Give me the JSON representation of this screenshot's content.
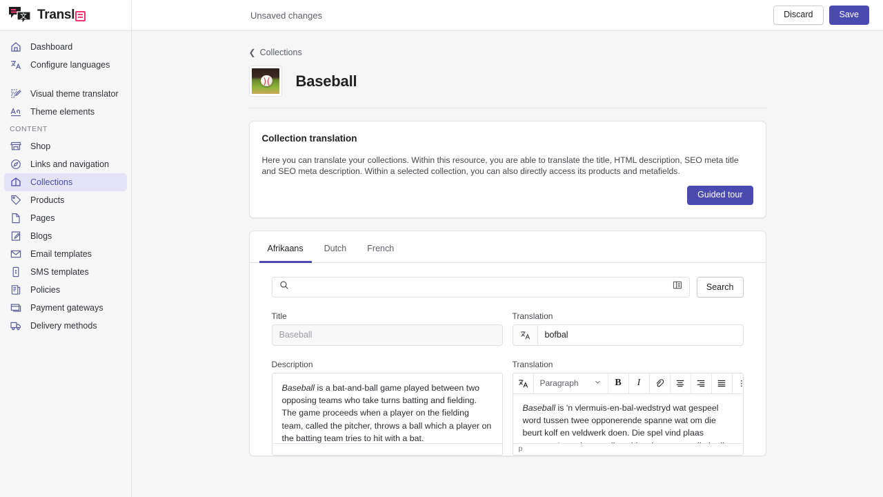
{
  "brand": {
    "name": "Transl",
    "badge_icon": "translate-badge-icon",
    "accent": "#f4366e"
  },
  "topbar": {
    "status": "Unsaved changes",
    "discard_label": "Discard",
    "save_label": "Save",
    "primary_color": "#4a4ab0"
  },
  "sidebar": {
    "primary": [
      {
        "label": "Dashboard",
        "icon": "home-icon"
      },
      {
        "label": "Configure languages",
        "icon": "translate-icon"
      }
    ],
    "theme": [
      {
        "label": "Visual theme translator",
        "icon": "theme-edit-icon"
      },
      {
        "label": "Theme elements",
        "icon": "typography-icon"
      }
    ],
    "content_heading": "CONTENT",
    "content": [
      {
        "label": "Shop",
        "icon": "store-icon",
        "active": false
      },
      {
        "label": "Links and navigation",
        "icon": "compass-icon",
        "active": false
      },
      {
        "label": "Collections",
        "icon": "collection-icon",
        "active": true
      },
      {
        "label": "Products",
        "icon": "tag-icon",
        "active": false
      },
      {
        "label": "Pages",
        "icon": "page-icon",
        "active": false
      },
      {
        "label": "Blogs",
        "icon": "blog-icon",
        "active": false
      },
      {
        "label": "Email templates",
        "icon": "email-icon",
        "active": false
      },
      {
        "label": "SMS templates",
        "icon": "sms-icon",
        "active": false
      },
      {
        "label": "Policies",
        "icon": "policy-icon",
        "active": false
      },
      {
        "label": "Payment gateways",
        "icon": "payment-icon",
        "active": false
      },
      {
        "label": "Delivery methods",
        "icon": "delivery-truck-icon",
        "active": false
      }
    ]
  },
  "page": {
    "breadcrumb": "Collections",
    "back_icon": "chevron-left-icon",
    "title": "Baseball",
    "thumbnail_icon": "baseball-collection-thumbnail"
  },
  "info_card": {
    "title": "Collection translation",
    "description": "Here you can translate your collections. Within this resource, you are able to translate the title, HTML description, SEO meta title and SEO meta description. Within a selected collection, you can also directly access its products and metafields.",
    "button_label": "Guided tour"
  },
  "tabs": [
    {
      "label": "Afrikaans",
      "active": true
    },
    {
      "label": "Dutch",
      "active": false
    },
    {
      "label": "French",
      "active": false
    }
  ],
  "search": {
    "value": "",
    "placeholder": "",
    "icon": "search-icon",
    "panel_icon": "side-panel-icon",
    "button_label": "Search"
  },
  "title_field": {
    "label": "Title",
    "value": "Baseball",
    "readonly": true
  },
  "title_translation": {
    "label": "Translation",
    "value": "bofbal",
    "icon": "translate-icon"
  },
  "description_field": {
    "label": "Description",
    "lead_italic": "Baseball",
    "body": " is a bat-and-ball game played between two opposing teams who take turns batting and fielding. The game proceeds when a player on the fielding team, called the pitcher, throws a ball which a player on the batting team tries to hit with a bat.",
    "status": ""
  },
  "description_translation": {
    "label": "Translation",
    "lead_italic": "Baseball",
    "body": " is 'n vlermuis-en-bal-wedstryd wat gespeel word tussen twee opponerende spanne wat om die beurt kolf en veldwerk doen. Die spel vind plaas wanneer 'n speler van die veldwerkspan, wat die kruik genoem word, 'n bal gooi wat 'n speler in die kolfspan",
    "status": "p",
    "toolbar": {
      "translate_icon": "translate-icon",
      "block_format": "Paragraph",
      "chevron_icon": "chevron-down-icon",
      "bold_label": "B",
      "italic_label": "I",
      "link_icon": "link-icon",
      "align_center_icon": "align-center-icon",
      "align_right_icon": "align-right-icon",
      "align_justify_icon": "align-justify-icon",
      "more_icon": "grip-more-icon"
    }
  }
}
